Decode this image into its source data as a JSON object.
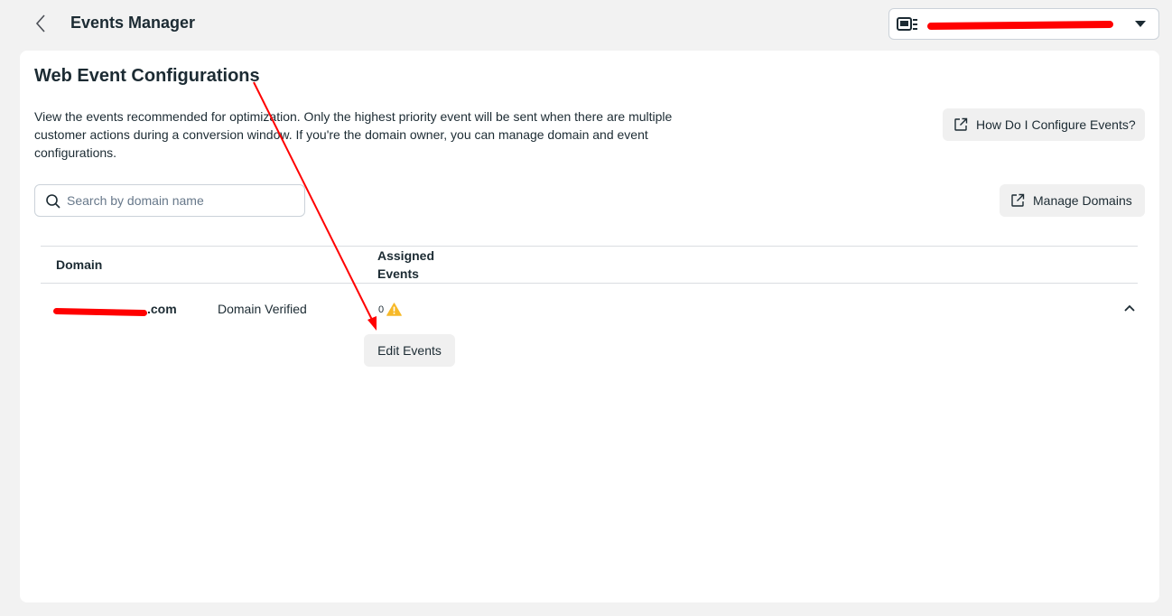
{
  "header": {
    "title": "Events Manager",
    "account_selector": {
      "label": ""
    }
  },
  "main": {
    "title": "Web Event Configurations",
    "description": "View the events recommended for optimization. Only the highest priority event will be sent when there are multiple customer actions during a conversion window. If you're the domain owner, you can manage domain and event configurations.",
    "help_button": "How Do I Configure Events?",
    "manage_domains_button": "Manage Domains",
    "search": {
      "placeholder": "Search by domain name",
      "value": ""
    }
  },
  "table": {
    "columns": [
      "Domain",
      "Assigned Events"
    ],
    "rows": [
      {
        "domain_suffix": ".com",
        "status": "Domain Verified",
        "assigned_events": "0",
        "edit_button": "Edit Events"
      }
    ]
  },
  "colors": {
    "accent_warning": "#f7b928",
    "annotation": "#ff0000",
    "redaction": "#ff0000"
  },
  "icons": [
    "back-chevron-icon",
    "ad-account-icon",
    "caret-down-icon",
    "external-link-icon",
    "search-icon",
    "warning-icon",
    "chevron-up-icon"
  ]
}
